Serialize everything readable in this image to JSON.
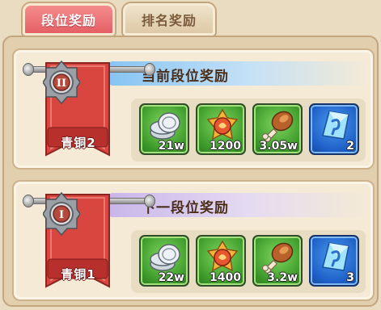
{
  "tabs": [
    {
      "label": "段位奖励",
      "active": true
    },
    {
      "label": "排名奖励",
      "active": false
    }
  ],
  "current": {
    "header": "当前段位奖励",
    "rank_label": "青铜2",
    "rank_numeral": "II",
    "banner_color": "#d9453f",
    "header_color": "#87c4f4",
    "items": [
      {
        "icon": "silver-coins-icon",
        "qty": "21w"
      },
      {
        "icon": "medal-token-icon",
        "qty": "1200"
      },
      {
        "icon": "roast-drumstick-icon",
        "qty": "3.05w"
      },
      {
        "icon": "blue-crystal-icon",
        "qty": "2"
      }
    ]
  },
  "next": {
    "header": "下一段位奖励",
    "rank_label": "青铜1",
    "rank_numeral": "I",
    "banner_color": "#d9453f",
    "header_color": "#c9b6ea",
    "items": [
      {
        "icon": "silver-coins-icon",
        "qty": "22w"
      },
      {
        "icon": "medal-token-icon",
        "qty": "1400"
      },
      {
        "icon": "roast-drumstick-icon",
        "qty": "3.2w"
      },
      {
        "icon": "blue-crystal-icon",
        "qty": "3"
      }
    ]
  }
}
